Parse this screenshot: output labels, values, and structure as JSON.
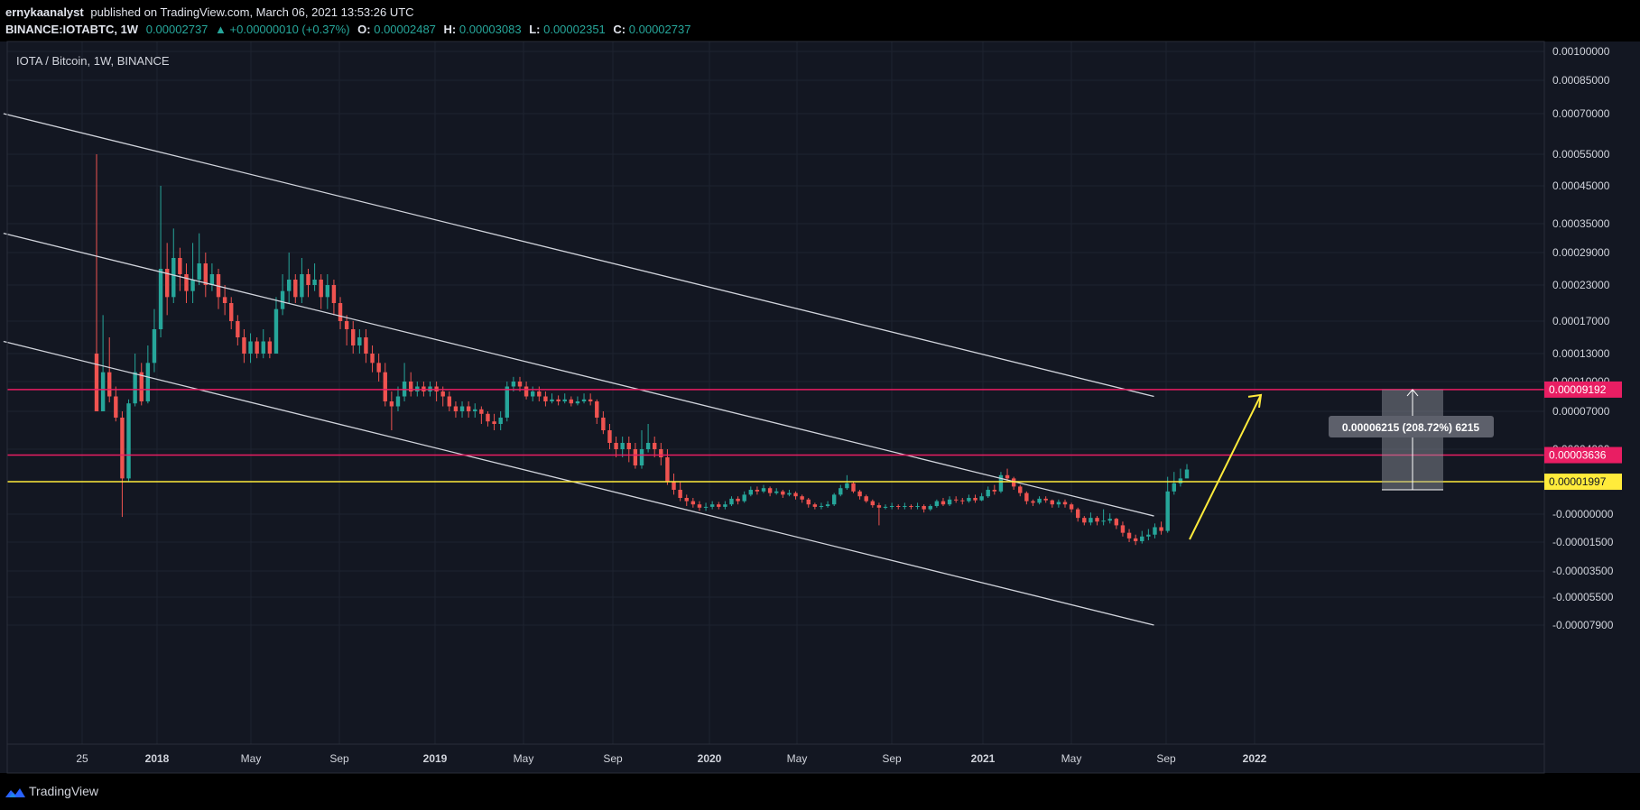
{
  "header": {
    "author": "ernykaanalyst",
    "published": "published on TradingView.com, March 06, 2021 13:53:26 UTC",
    "symbol": "BINANCE:IOTABTC, 1W",
    "last": "0.00002737",
    "arrow": "▲",
    "change": "+0.00000010 (+0.37%)",
    "o_label": "O:",
    "o_value": "0.00002487",
    "h_label": "H:",
    "h_value": "0.00003083",
    "l_label": "L:",
    "l_value": "0.00002351",
    "c_label": "C:",
    "c_value": "0.00002737"
  },
  "chart_title": "IOTA / Bitcoin, 1W, BINANCE",
  "footer": {
    "brand": "TradingView"
  },
  "colors": {
    "bg": "#131722",
    "grid": "#1e2330",
    "text": "#d1d4dc",
    "up": "#26a69a",
    "down": "#ef5350",
    "pink": "#e91e63",
    "yellow": "#ffeb3b",
    "channel": "#d1d4dc"
  },
  "chart_data": {
    "type": "candlestick",
    "title": "IOTA / Bitcoin, 1W, BINANCE",
    "y_ticks": [
      "0.00100000",
      "0.00085000",
      "0.00070000",
      "0.00055000",
      "0.00045000",
      "0.00035000",
      "0.00029000",
      "0.00023000",
      "0.00017000",
      "0.00013000",
      "0.00010000",
      "0.00007000",
      "0.00004000",
      "-0.00000000",
      "-0.00001500",
      "-0.00003500",
      "-0.00005500",
      "-0.00007900"
    ],
    "x_ticks": [
      "25",
      "2018",
      "May",
      "Sep",
      "2019",
      "May",
      "Sep",
      "2020",
      "May",
      "Sep",
      "2021",
      "May",
      "Sep",
      "2022"
    ],
    "price_labels": [
      {
        "text": "0.00009192",
        "color": "#e91e63"
      },
      {
        "text": "0.00003636",
        "color": "#e91e63"
      },
      {
        "text": "0.00001997",
        "color": "#ffeb3b"
      }
    ],
    "horizontal_levels": [
      {
        "value": 9.192e-05,
        "color": "#e91e63"
      },
      {
        "value": 3.636e-05,
        "color": "#e91e63"
      },
      {
        "value": 1.997e-05,
        "color": "#ffeb3b"
      }
    ],
    "measure_label": "0.00006215 (208.72%) 6215",
    "channel_lines": [
      {
        "from": [
          "2017-06",
          "0.00070000"
        ],
        "to": [
          "2021-08",
          "0.00008500"
        ]
      },
      {
        "from": [
          "2017-06",
          "0.00033000"
        ],
        "to": [
          "2021-08",
          "-0.00000100"
        ]
      },
      {
        "from": [
          "2017-06",
          "0.00014500"
        ],
        "to": [
          "2021-08",
          "-0.00007900"
        ]
      }
    ],
    "candles": [
      [
        0.00013,
        7e-05,
        0.00055,
        7e-05
      ],
      [
        7e-05,
        0.00011,
        0.00018,
        7e-05
      ],
      [
        0.00011,
        8.5e-05,
        0.00015,
        7.9e-05
      ],
      [
        8.5e-05,
        6.5e-05,
        9.5e-05,
        6.2e-05
      ],
      [
        6.5e-05,
        2.2e-05,
        7e-05,
        -1.5e-06
      ],
      [
        2.2e-05,
        7.8e-05,
        8.2e-05,
        2e-05
      ],
      [
        7.8e-05,
        0.00011,
        0.00013,
        7.5e-05
      ],
      [
        0.00011,
        8e-05,
        0.00012,
        7.6e-05
      ],
      [
        8e-05,
        0.00012,
        0.00014,
        7.8e-05
      ],
      [
        0.00012,
        0.00016,
        0.00019,
        0.00011
      ],
      [
        0.00016,
        0.00026,
        0.00045,
        0.00015
      ],
      [
        0.00026,
        0.00021,
        0.00031,
        0.00018
      ],
      [
        0.00021,
        0.00028,
        0.00034,
        0.0002
      ],
      [
        0.00028,
        0.00025,
        0.0003,
        0.00022
      ],
      [
        0.00025,
        0.00022,
        0.00027,
        0.0002
      ],
      [
        0.00022,
        0.00024,
        0.00031,
        0.0002
      ],
      [
        0.00024,
        0.00027,
        0.00033,
        0.00023
      ],
      [
        0.00027,
        0.00023,
        0.00029,
        0.00021
      ],
      [
        0.00023,
        0.00025,
        0.00027,
        0.00022
      ],
      [
        0.00025,
        0.00021,
        0.00026,
        0.00019
      ],
      [
        0.00021,
        0.0002,
        0.00023,
        0.00018
      ],
      [
        0.0002,
        0.00017,
        0.00021,
        0.00016
      ],
      [
        0.00017,
        0.00015,
        0.00018,
        0.00014
      ],
      [
        0.00015,
        0.00013,
        0.00016,
        0.00012
      ],
      [
        0.00013,
        0.000145,
        0.000155,
        0.00012
      ],
      [
        0.000145,
        0.00013,
        0.00015,
        0.000125
      ],
      [
        0.00013,
        0.000145,
        0.00016,
        0.000125
      ],
      [
        0.000145,
        0.00013,
        0.00015,
        0.000125
      ],
      [
        0.00013,
        0.00019,
        0.00021,
        0.00013
      ],
      [
        0.00019,
        0.00022,
        0.00025,
        0.00018
      ],
      [
        0.00022,
        0.00024,
        0.00029,
        0.0002
      ],
      [
        0.00024,
        0.00021,
        0.00025,
        0.0002
      ],
      [
        0.00021,
        0.00025,
        0.00028,
        0.0002
      ],
      [
        0.00025,
        0.00023,
        0.00026,
        0.00021
      ],
      [
        0.00023,
        0.00024,
        0.00027,
        0.00022
      ],
      [
        0.00024,
        0.00021,
        0.00025,
        0.00019
      ],
      [
        0.00021,
        0.00023,
        0.00025,
        0.00019
      ],
      [
        0.00023,
        0.0002,
        0.00024,
        0.00018
      ],
      [
        0.0002,
        0.00017,
        0.00021,
        0.00016
      ],
      [
        0.00017,
        0.00016,
        0.00018,
        0.00014
      ],
      [
        0.00016,
        0.00014,
        0.00017,
        0.00013
      ],
      [
        0.00014,
        0.00015,
        0.00016,
        0.00013
      ],
      [
        0.00015,
        0.00013,
        0.00016,
        0.00012
      ],
      [
        0.00013,
        0.00012,
        0.00014,
        0.00011
      ],
      [
        0.00012,
        0.00011,
        0.00013,
        0.0001
      ],
      [
        0.00011,
        8e-05,
        0.00012,
        7.5e-05
      ],
      [
        8e-05,
        7.5e-05,
        9e-05,
        5.5e-05
      ],
      [
        7.5e-05,
        8.5e-05,
        9.5e-05,
        7e-05
      ],
      [
        8.5e-05,
        0.0001,
        0.00012,
        8e-05
      ],
      [
        0.0001,
        9e-05,
        0.00011,
        8.5e-05
      ],
      [
        9e-05,
        9.5e-05,
        0.0001,
        8.5e-05
      ],
      [
        9.5e-05,
        9e-05,
        0.0001,
        8.5e-05
      ],
      [
        9e-05,
        9.5e-05,
        0.0001,
        8.5e-05
      ],
      [
        9.5e-05,
        9e-05,
        0.0001,
        8e-05
      ],
      [
        9e-05,
        8.5e-05,
        9.5e-05,
        7.5e-05
      ],
      [
        8.5e-05,
        7.5e-05,
        9e-05,
        7e-05
      ],
      [
        7.5e-05,
        7e-05,
        8e-05,
        6.5e-05
      ],
      [
        7e-05,
        7.5e-05,
        8e-05,
        6.5e-05
      ],
      [
        7.5e-05,
        7e-05,
        8e-05,
        6.5e-05
      ],
      [
        7e-05,
        7.2e-05,
        7.8e-05,
        6.5e-05
      ],
      [
        7.2e-05,
        6.8e-05,
        7.5e-05,
        6e-05
      ],
      [
        6.8e-05,
        6.2e-05,
        7e-05,
        5.8e-05
      ],
      [
        6.2e-05,
        6e-05,
        6.8e-05,
        5.5e-05
      ],
      [
        6e-05,
        6.5e-05,
        7e-05,
        5.5e-05
      ],
      [
        6.5e-05,
        9.5e-05,
        0.0001,
        6.2e-05
      ],
      [
        9.5e-05,
        0.0001,
        0.000105,
        9e-05
      ],
      [
        0.0001,
        9.5e-05,
        0.000105,
        9e-05
      ],
      [
        9.5e-05,
        8.5e-05,
        0.0001,
        8.2e-05
      ],
      [
        8.5e-05,
        9e-05,
        9.5e-05,
        8e-05
      ],
      [
        9e-05,
        8.5e-05,
        9.5e-05,
        8e-05
      ],
      [
        8.5e-05,
        8e-05,
        9e-05,
        7.5e-05
      ],
      [
        8e-05,
        8.2e-05,
        8.8e-05,
        7.8e-05
      ],
      [
        8.2e-05,
        8e-05,
        8.6e-05,
        7.6e-05
      ],
      [
        8e-05,
        8.2e-05,
        8.8e-05,
        7.8e-05
      ],
      [
        8.2e-05,
        7.8e-05,
        8.5e-05,
        7.5e-05
      ],
      [
        7.8e-05,
        8e-05,
        8.5e-05,
        7.6e-05
      ],
      [
        8e-05,
        8.2e-05,
        8.8e-05,
        7.8e-05
      ],
      [
        8.2e-05,
        8e-05,
        8.8e-05,
        7.6e-05
      ],
      [
        8e-05,
        6.5e-05,
        8.2e-05,
        6e-05
      ],
      [
        6.5e-05,
        5.5e-05,
        7e-05,
        5.2e-05
      ],
      [
        5.5e-05,
        4.5e-05,
        6e-05,
        4e-05
      ],
      [
        4.5e-05,
        4e-05,
        5e-05,
        3.5e-05
      ],
      [
        4e-05,
        4.5e-05,
        5e-05,
        3.5e-05
      ],
      [
        4.5e-05,
        4e-05,
        5e-05,
        3.2e-05
      ],
      [
        4e-05,
        3e-05,
        4.5e-05,
        2.8e-05
      ],
      [
        3e-05,
        4e-05,
        5.5e-05,
        2.8e-05
      ],
      [
        4e-05,
        4.5e-05,
        6e-05,
        3.8e-05
      ],
      [
        4.5e-05,
        4e-05,
        5e-05,
        3.5e-05
      ],
      [
        4e-05,
        3.5e-05,
        4.5e-05,
        3e-05
      ],
      [
        3.5e-05,
        2e-05,
        4e-05,
        1.8e-05
      ],
      [
        2e-05,
        1.5e-05,
        2.5e-05,
        1.2e-05
      ],
      [
        1.5e-05,
        1e-05,
        2e-05,
        8e-06
      ],
      [
        1e-05,
        8e-06,
        1.2e-05,
        5e-06
      ],
      [
        8e-06,
        6e-06,
        1e-05,
        4e-06
      ],
      [
        6e-06,
        4e-06,
        8e-06,
        2e-06
      ],
      [
        4e-06,
        4.5e-06,
        7e-06,
        2e-06
      ],
      [
        4.5e-06,
        6e-06,
        8e-06,
        3e-06
      ],
      [
        6e-06,
        4.5e-06,
        7.5e-06,
        3e-06
      ],
      [
        4.5e-06,
        6e-06,
        8e-06,
        3e-06
      ],
      [
        6e-06,
        9.5e-06,
        1.1e-05,
        5e-06
      ],
      [
        9.5e-06,
        8e-06,
        1.1e-05,
        6e-06
      ],
      [
        8e-06,
        1.2e-05,
        1.4e-05,
        7e-06
      ],
      [
        1.2e-05,
        1.5e-05,
        1.7e-05,
        1.1e-05
      ],
      [
        1.5e-05,
        1.4e-05,
        1.7e-05,
        1.2e-05
      ],
      [
        1.4e-05,
        1.6e-05,
        1.8e-05,
        1.3e-05
      ],
      [
        1.6e-05,
        1.3e-05,
        1.7e-05,
        1.1e-05
      ],
      [
        1.3e-05,
        1.4e-05,
        1.6e-05,
        1.2e-05
      ],
      [
        1.4e-05,
        1.2e-05,
        1.5e-05,
        1e-05
      ],
      [
        1.2e-05,
        1.3e-05,
        1.5e-05,
        1.1e-05
      ],
      [
        1.3e-05,
        1.1e-05,
        1.4e-05,
        9e-06
      ],
      [
        1.1e-05,
        9e-06,
        1.2e-05,
        7e-06
      ],
      [
        9e-06,
        6e-06,
        1e-05,
        4e-06
      ],
      [
        6e-06,
        4.5e-06,
        7e-06,
        3e-06
      ],
      [
        4.5e-06,
        5e-06,
        7e-06,
        3e-06
      ],
      [
        5e-06,
        6e-06,
        8e-06,
        4e-06
      ],
      [
        6e-06,
        1.2e-05,
        1.3e-05,
        5e-06
      ],
      [
        1.2e-05,
        1.6e-05,
        1.8e-05,
        1.1e-05
      ],
      [
        1.6e-05,
        1.9e-05,
        2.4e-05,
        1.5e-05
      ],
      [
        1.9e-05,
        1.4e-05,
        2e-05,
        1.3e-05
      ],
      [
        1.4e-05,
        1.1e-05,
        1.5e-05,
        9e-06
      ],
      [
        1.1e-05,
        8e-06,
        1.2e-05,
        7e-06
      ],
      [
        8e-06,
        5.5e-06,
        9e-06,
        4e-06
      ],
      [
        5.5e-06,
        4e-06,
        7e-06,
        -6e-06
      ],
      [
        4e-06,
        4.5e-06,
        6e-06,
        3e-06
      ],
      [
        4.5e-06,
        5e-06,
        7e-06,
        3e-06
      ],
      [
        5e-06,
        4.5e-06,
        6e-06,
        3e-06
      ],
      [
        4.5e-06,
        5e-06,
        7e-06,
        3e-06
      ],
      [
        5e-06,
        4.5e-06,
        6e-06,
        3e-06
      ],
      [
        4.5e-06,
        5e-06,
        7e-06,
        3e-06
      ],
      [
        5e-06,
        3e-06,
        6e-06,
        1e-06
      ],
      [
        3e-06,
        5e-06,
        6e-06,
        2e-06
      ],
      [
        5e-06,
        8e-06,
        9e-06,
        4e-06
      ],
      [
        8e-06,
        6e-06,
        1e-05,
        5e-06
      ],
      [
        6e-06,
        9e-06,
        1.1e-05,
        5e-06
      ],
      [
        9e-06,
        8.5e-06,
        1.1e-05,
        7e-06
      ],
      [
        8.5e-06,
        8e-06,
        1e-05,
        6e-06
      ],
      [
        8e-06,
        1e-05,
        1.2e-05,
        7e-06
      ],
      [
        1e-05,
        8.5e-06,
        1.2e-05,
        7e-06
      ],
      [
        8.5e-06,
        1.1e-05,
        1.3e-05,
        8e-06
      ],
      [
        1.1e-05,
        1.5e-05,
        1.7e-05,
        1e-05
      ],
      [
        1.5e-05,
        1.4e-05,
        1.8e-05,
        1.2e-05
      ],
      [
        1.4e-05,
        2.4e-05,
        2.6e-05,
        1.3e-05
      ],
      [
        2.4e-05,
        2.2e-05,
        2.8e-05,
        2e-05
      ],
      [
        2.2e-05,
        1.7e-05,
        2.3e-05,
        1.5e-05
      ],
      [
        1.7e-05,
        1.3e-05,
        1.8e-05,
        1.1e-05
      ],
      [
        1.3e-05,
        8e-06,
        1.4e-05,
        6e-06
      ],
      [
        8e-06,
        7e-06,
        9e-06,
        5e-06
      ],
      [
        7e-06,
        9.5e-06,
        1.1e-05,
        6e-06
      ],
      [
        9.5e-06,
        8.5e-06,
        1.1e-05,
        7e-06
      ],
      [
        8.5e-06,
        6e-06,
        9e-06,
        4e-06
      ],
      [
        6e-06,
        7.5e-06,
        9e-06,
        4e-06
      ],
      [
        7.5e-06,
        6e-06,
        9e-06,
        4e-06
      ],
      [
        6e-06,
        3e-06,
        7e-06,
        1e-06
      ],
      [
        3e-06,
        -2e-06,
        4e-06,
        -4e-06
      ],
      [
        -2e-06,
        -4.5e-06,
        -1e-06,
        -6e-06
      ],
      [
        -4.5e-06,
        -2e-06,
        1e-06,
        -6e-06
      ],
      [
        -2e-06,
        -4e-06,
        -1e-06,
        -6e-06
      ],
      [
        -4e-06,
        -3.5e-06,
        3e-06,
        -6e-06
      ],
      [
        -3.5e-06,
        -2.5e-06,
        5e-07,
        -5e-06
      ],
      [
        -2.5e-06,
        -6e-06,
        -2e-06,
        -8e-06
      ],
      [
        -6e-06,
        -1e-05,
        -4e-06,
        -1.2e-05
      ],
      [
        -1e-05,
        -1.3e-05,
        -8e-06,
        -1.5e-05
      ],
      [
        -1.3e-05,
        -1.45e-05,
        -1.1e-05,
        -1.7e-05
      ],
      [
        -1.45e-05,
        -1.2e-05,
        -9e-06,
        -1.6e-05
      ],
      [
        -1.2e-05,
        -1.1e-05,
        -8e-06,
        -1.4e-05
      ],
      [
        -1.1e-05,
        -7e-06,
        -5e-06,
        -1.3e-05
      ],
      [
        -7e-06,
        -9e-06,
        -4e-06,
        -1.1e-05
      ],
      [
        -9e-06,
        1.4e-05,
        2.3e-05,
        -1e-05
      ],
      [
        1.4e-05,
        1.9e-05,
        2.6e-05,
        1.2e-05
      ],
      [
        1.9e-05,
        2.2e-05,
        2.8e-05,
        1.7e-05
      ],
      [
        2.2e-05,
        2.75e-05,
        3.083e-05,
        2.351e-05
      ]
    ]
  }
}
